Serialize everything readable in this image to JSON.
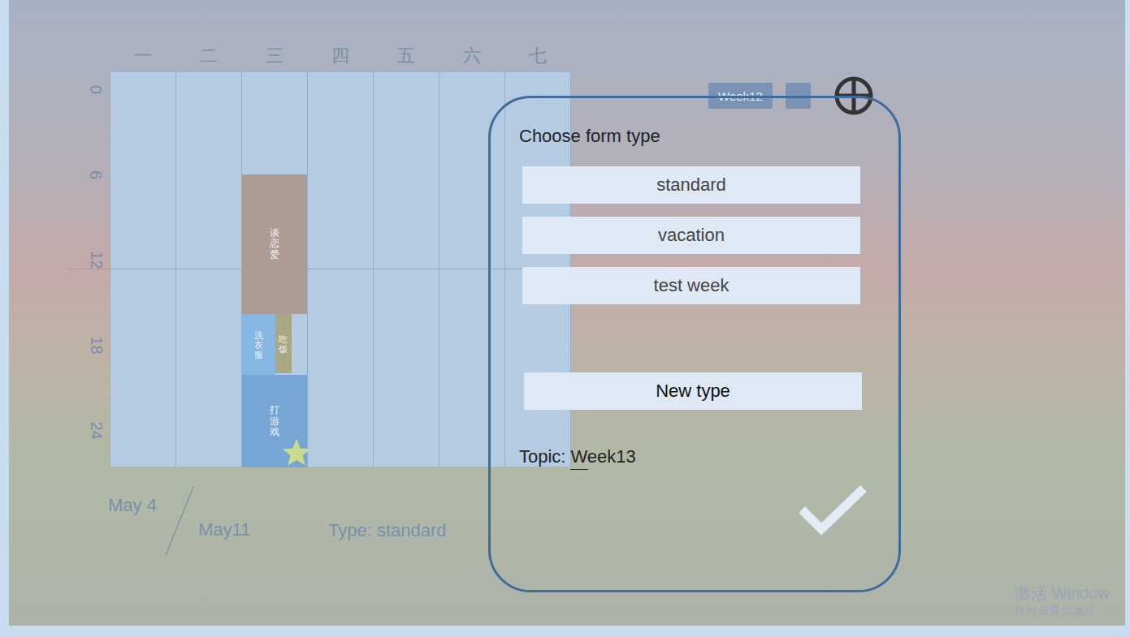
{
  "week_days": [
    {
      "label": "一",
      "starred": false
    },
    {
      "label": "二",
      "starred": false
    },
    {
      "label": "三",
      "starred": true
    },
    {
      "label": "四",
      "starred": false
    },
    {
      "label": "五",
      "starred": false
    },
    {
      "label": "六",
      "starred": false
    },
    {
      "label": "七",
      "starred": false
    }
  ],
  "hours": [
    "0",
    "6",
    "12",
    "18",
    "24"
  ],
  "events": [
    {
      "title": "谈恋爱",
      "day": 3,
      "start": 6.2,
      "end": 14.7,
      "lane": "full",
      "color": "#ad9c95"
    },
    {
      "title": "洗衣服",
      "day": 3,
      "start": 14.7,
      "end": 18.4,
      "lane": "left",
      "color": "#86b6e2"
    },
    {
      "title": "吃饭",
      "day": 3,
      "start": 14.7,
      "end": 18.3,
      "lane": "right",
      "color": "#a8a983"
    },
    {
      "title": "打游戏",
      "day": 3,
      "start": 18.4,
      "end": 24,
      "lane": "full",
      "color": "#78a6d4"
    }
  ],
  "range": {
    "start": "May 4",
    "end": "May11"
  },
  "type_label": "Type: standard",
  "toolbar": {
    "week_button": "Week12",
    "more_button": "···"
  },
  "dialog": {
    "title": "Choose form type",
    "options": [
      {
        "label": "standard",
        "selected": false
      },
      {
        "label": "vacation",
        "selected": false
      },
      {
        "label": "test week",
        "selected": false
      }
    ],
    "new_type": "New type",
    "topic_label": "Topic:",
    "topic_value": "Week13"
  },
  "watermark": {
    "line1": "激活 Window",
    "line2": "转到 设置 以激活"
  }
}
